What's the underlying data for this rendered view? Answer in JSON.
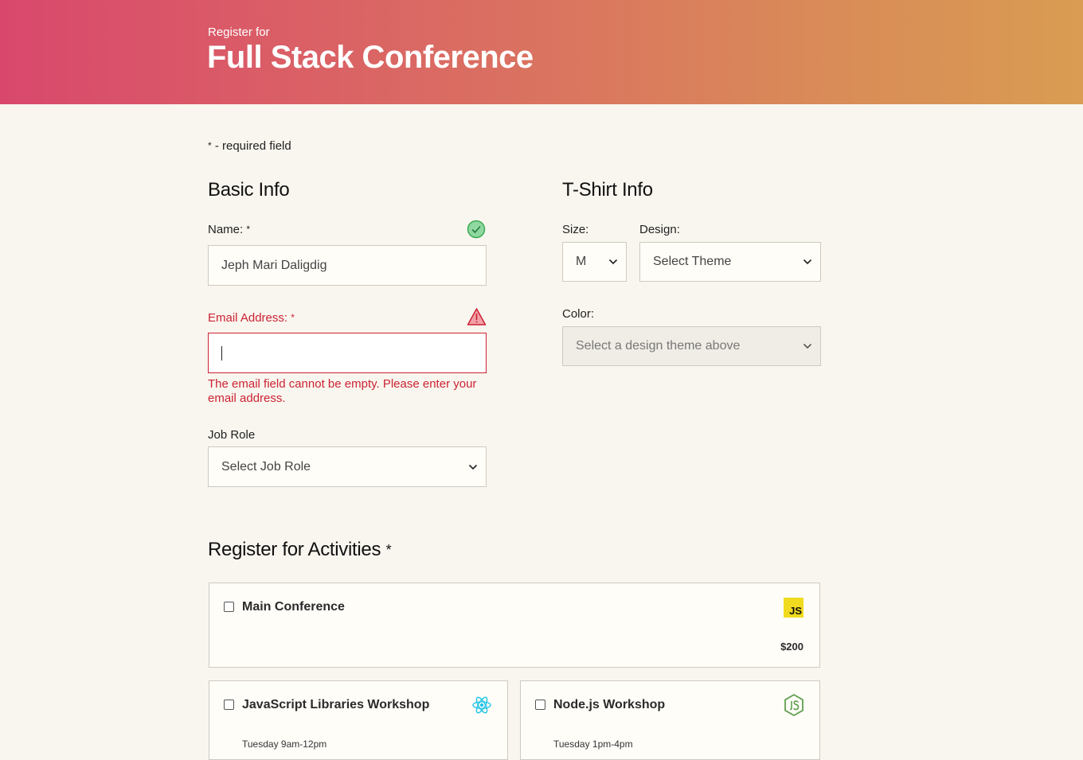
{
  "header": {
    "subtitle": "Register for",
    "title": "Full Stack Conference"
  },
  "required_note": {
    "marker": "*",
    "text": " - required field"
  },
  "basic_info": {
    "heading": "Basic Info",
    "name": {
      "label": "Name:",
      "required_marker": "*",
      "value": "Jeph Mari Daligdig",
      "status": "valid"
    },
    "email": {
      "label": "Email Address:",
      "required_marker": "*",
      "value": "",
      "status": "error",
      "error_message": "The email field cannot be empty. Please enter your email address."
    },
    "job_role": {
      "label": "Job Role",
      "selected": "Select Job Role"
    }
  },
  "tshirt_info": {
    "heading": "T-Shirt Info",
    "size": {
      "label": "Size:",
      "selected": "M"
    },
    "design": {
      "label": "Design:",
      "selected": "Select Theme"
    },
    "color": {
      "label": "Color:",
      "selected": "Select a design theme above",
      "disabled": true
    }
  },
  "activities": {
    "heading": "Register for Activities",
    "required_marker": "*",
    "items": [
      {
        "title": "Main Conference",
        "price": "$200",
        "icon": "js-icon",
        "checked": false
      },
      {
        "title": "JavaScript Libraries Workshop",
        "time": "Tuesday 9am-12pm",
        "icon": "react-icon",
        "checked": false
      },
      {
        "title": "Node.js Workshop",
        "time": "Tuesday 1pm-4pm",
        "icon": "nodejs-icon",
        "checked": false
      }
    ],
    "js_logo_text": "JS"
  },
  "colors": {
    "header_gradient_start": "#d9486c",
    "header_gradient_end": "#d99c52",
    "background": "#f9f6ef",
    "error": "#cc2233",
    "valid": "#3aaa55"
  }
}
